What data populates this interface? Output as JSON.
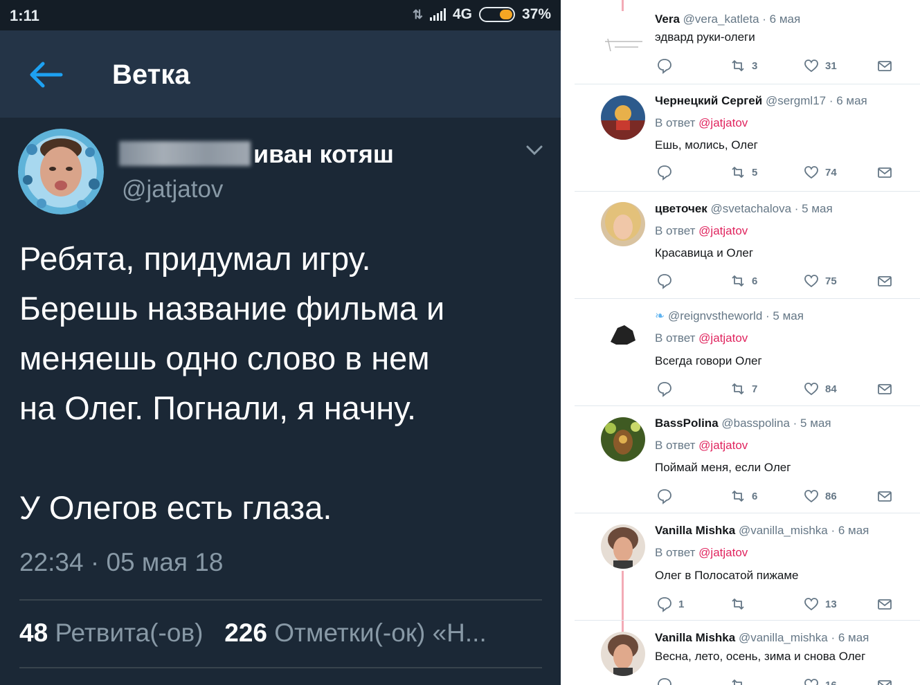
{
  "status_bar": {
    "time": "1:11",
    "network": "4G",
    "battery": "37%"
  },
  "app_bar": {
    "title": "Ветка"
  },
  "tweet": {
    "display_name": "иван котяш",
    "handle": "@jatjatov",
    "lines": [
      "Ребята, придумал игру.",
      "Берешь название фильма и",
      "меняешь одно слово в нем",
      "на Олег. Погнали, я начну."
    ],
    "last_line": "У Олегов есть глаза.",
    "timestamp": "22:34 · 05 мая 18",
    "retweets_count": "48",
    "retweets_label": "Ретвита(-ов)",
    "likes_count": "226",
    "likes_label": "Отметки(-ок) «Н..."
  },
  "replies": [
    {
      "name": "Vera",
      "handle": "@vera_katleta",
      "date": "6 мая",
      "reply_to": "",
      "text": "эдвард руки-олеги",
      "replies": "",
      "retweets": "3",
      "likes": "31"
    },
    {
      "name": "Чернецкий Сергей",
      "handle": "@sergml17",
      "date": "6 мая",
      "reply_prefix": "В ответ",
      "reply_to": "@jatjatov",
      "text": "Ешь, молись, Олег",
      "replies": "",
      "retweets": "5",
      "likes": "74"
    },
    {
      "name": "цветочек",
      "handle": "@svetachalova",
      "date": "5 мая",
      "reply_prefix": "В ответ",
      "reply_to": "@jatjatov",
      "text": "Красавица и Олег",
      "replies": "",
      "retweets": "6",
      "likes": "75"
    },
    {
      "name": "",
      "handle": "@reignvstheworld",
      "date": "5 мая",
      "reply_prefix": "В ответ",
      "reply_to": "@jatjatov",
      "text": "Всегда говори Олег",
      "replies": "",
      "retweets": "7",
      "likes": "84"
    },
    {
      "name": "BassPolina",
      "handle": "@basspolina",
      "date": "5 мая",
      "reply_prefix": "В ответ",
      "reply_to": "@jatjatov",
      "text": "Поймай меня, если Олег",
      "replies": "",
      "retweets": "6",
      "likes": "86"
    },
    {
      "name": "Vanilla Mishka",
      "handle": "@vanilla_mishka",
      "date": "6 мая",
      "reply_prefix": "В ответ",
      "reply_to": "@jatjatov",
      "text": "Олег в Полосатой пижаме",
      "replies": "1",
      "retweets": "",
      "likes": "13"
    },
    {
      "name": "Vanilla Mishka",
      "handle": "@vanilla_mishka",
      "date": "6 мая",
      "reply_to": "",
      "text": "Весна, лето, осень, зима и снова Олег",
      "replies": "",
      "retweets": "",
      "likes": "16"
    }
  ],
  "colors": {
    "dark_bg": "#1b2836",
    "app_bar": "#243447",
    "mention": "#e0245e",
    "thread": "#f3aab5"
  }
}
